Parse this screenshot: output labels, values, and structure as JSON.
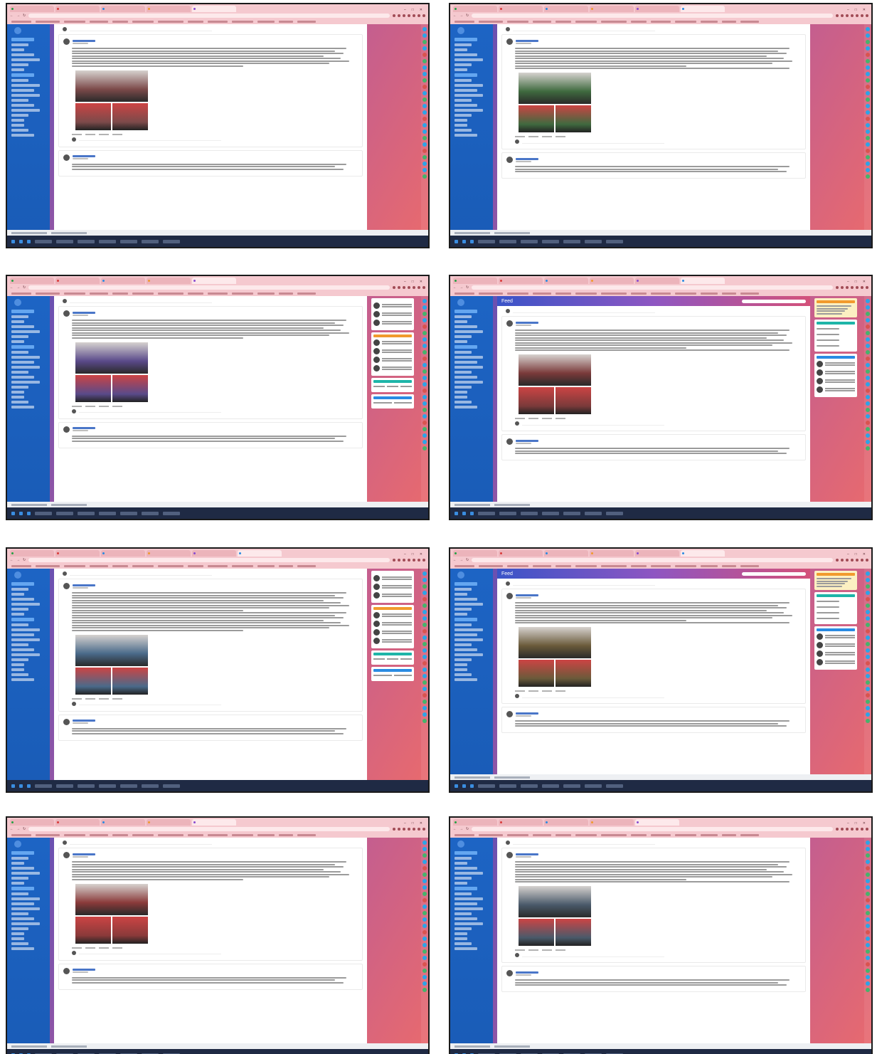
{
  "grid": {
    "rows": 4,
    "cols": 2
  },
  "shots": [
    {
      "id": "top-left",
      "has_right_panel": false,
      "has_feed_header": false,
      "tab_count": 5,
      "accent": "#1d64c4"
    },
    {
      "id": "top-right",
      "has_right_panel": false,
      "has_feed_header": false,
      "tab_count": 6,
      "accent": "#1d64c4"
    },
    {
      "id": "row2-left",
      "has_right_panel": true,
      "has_feed_header": false,
      "tab_count": 5,
      "accent": "#1d64c4"
    },
    {
      "id": "row2-right",
      "has_right_panel": true,
      "has_feed_header": true,
      "feed_label": "Feed",
      "tab_count": 6,
      "accent": "#1d64c4"
    },
    {
      "id": "row3-left",
      "has_right_panel": true,
      "has_feed_header": false,
      "tab_count": 6,
      "accent": "#1d64c4"
    },
    {
      "id": "row3-right",
      "has_right_panel": true,
      "has_feed_header": true,
      "feed_label": "Feed",
      "tab_count": 6,
      "accent": "#1d64c4"
    },
    {
      "id": "bottom-left",
      "has_right_panel": false,
      "has_feed_header": false,
      "tab_count": 5,
      "accent": "#1d64c4"
    },
    {
      "id": "bottom-right",
      "has_right_panel": false,
      "has_feed_header": false,
      "tab_count": 5,
      "accent": "#1d64c4"
    }
  ],
  "colors": {
    "sidebar": "#1d64c4",
    "browser_chrome": "#f5c9cf",
    "widget_orange": "#f19a2d",
    "widget_blue": "#2a8be2",
    "widget_teal": "#1eb5a8",
    "taskbar": "#1f2a44"
  },
  "icons": [
    "back-icon",
    "forward-icon",
    "reload-icon",
    "minimize-icon",
    "maximize-icon",
    "close-icon"
  ]
}
